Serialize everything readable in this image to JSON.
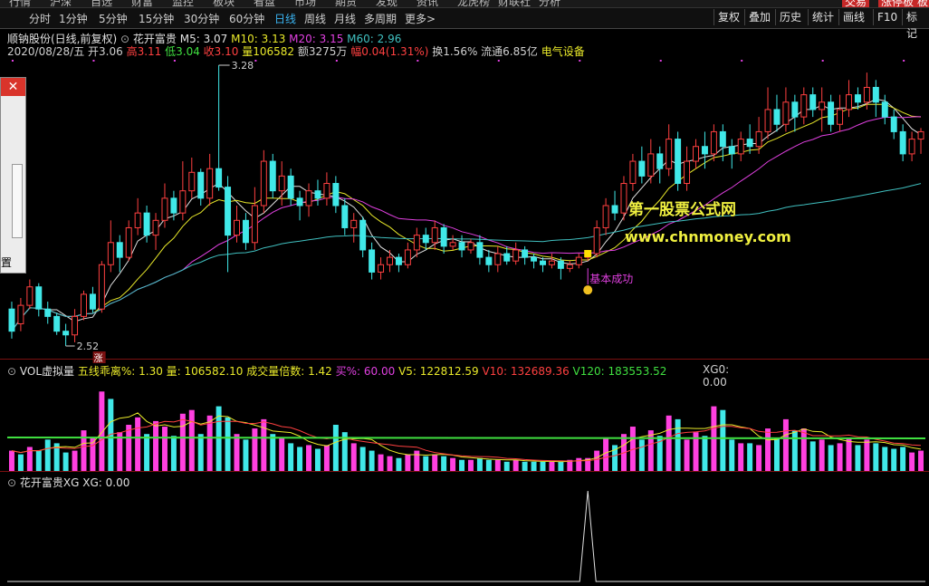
{
  "topmenu": {
    "items": [
      "行情",
      "沪深",
      "自选",
      "财富",
      "监控",
      "板块",
      "看盘",
      "市场",
      "期货",
      "发现",
      "资讯",
      "龙虎榜",
      "财联社",
      "分析"
    ],
    "right_items": [
      "交易",
      "涨停板",
      "板"
    ]
  },
  "tabs": {
    "items": [
      "分时",
      "1分钟",
      "5分钟",
      "15分钟",
      "30分钟",
      "60分钟",
      "日线",
      "周线",
      "月线",
      "多周期",
      "更多"
    ],
    "active": "日线",
    "right_buttons": [
      "复权",
      "叠加",
      "历史",
      "统计",
      "画线",
      "F10",
      "标记"
    ]
  },
  "stock": {
    "name_line": "顺钠股份(日线,前复权)",
    "indicator_name": "花开富贵",
    "ma": [
      {
        "label": "M5: 3.07",
        "color": "#e0e0e0"
      },
      {
        "label": "M10: 3.13",
        "color": "#e8e82a"
      },
      {
        "label": "M20: 3.15",
        "color": "#e040e0"
      },
      {
        "label": "M60: 2.96",
        "color": "#40c0c0"
      }
    ],
    "quote": [
      {
        "text": "2020/08/28/五",
        "color": "#d0d0d0"
      },
      {
        "text": "开3.06",
        "color": "#d0d0d0"
      },
      {
        "text": "高3.11",
        "color": "#ff4040"
      },
      {
        "text": "低3.04",
        "color": "#40e040"
      },
      {
        "text": "收3.10",
        "color": "#ff4040"
      },
      {
        "text": "量106582",
        "color": "#e8e82a"
      },
      {
        "text": "额3275万",
        "color": "#d0d0d0"
      },
      {
        "text": "幅0.04(1.31%)",
        "color": "#ff4040"
      },
      {
        "text": "换1.56%",
        "color": "#d0d0d0"
      },
      {
        "text": "流通6.85亿",
        "color": "#d0d0d0"
      },
      {
        "text": "电气设备",
        "color": "#e8e82a"
      }
    ],
    "high_label": "3.28",
    "low_label": "2.52",
    "zhang_badge": "涨",
    "signal_label": "基本成功",
    "watermark_line1": "第一股票公式网",
    "watermark_line2": "www.chnmoney.com"
  },
  "volume_pane": {
    "title": "VOL虚拟量",
    "fields": [
      {
        "text": "五线乖离%: 1.30",
        "color": "#e8e82a"
      },
      {
        "text": "量: 106582.10",
        "color": "#e8e82a"
      },
      {
        "text": "成交量倍数: 1.42",
        "color": "#e8e82a"
      },
      {
        "text": "买%: 60.00",
        "color": "#e040e0"
      },
      {
        "text": "V5: 122812.59",
        "color": "#e8e82a"
      },
      {
        "text": "V10: 132689.36",
        "color": "#ff4040"
      },
      {
        "text": "V120: 183553.52",
        "color": "#40e040"
      },
      {
        "text": "XG0: 0.00",
        "color": "#d0d0d0"
      }
    ]
  },
  "xg_pane": {
    "title": "花开富贵XG",
    "value": "XG: 0.00"
  },
  "dialog": {
    "close_symbol": "✕",
    "partial_text": "置"
  },
  "colors": {
    "up": "#ff4040",
    "down": "#40e8e8",
    "ma5": "#e0e0e0",
    "ma10": "#e8e82a",
    "ma20": "#e040e0",
    "ma60": "#40c0c0",
    "vol_up": "#ff40e0",
    "vol_down": "#40e8e8"
  },
  "chart_data": {
    "type": "candlestick",
    "ylim": [
      2.52,
      3.28
    ],
    "candles": [
      {
        "o": 2.62,
        "c": 2.56,
        "h": 2.64,
        "l": 2.54
      },
      {
        "o": 2.58,
        "c": 2.63,
        "h": 2.65,
        "l": 2.56
      },
      {
        "o": 2.63,
        "c": 2.68,
        "h": 2.7,
        "l": 2.62
      },
      {
        "o": 2.68,
        "c": 2.62,
        "h": 2.69,
        "l": 2.6
      },
      {
        "o": 2.62,
        "c": 2.6,
        "h": 2.64,
        "l": 2.58
      },
      {
        "o": 2.6,
        "c": 2.56,
        "h": 2.61,
        "l": 2.55
      },
      {
        "o": 2.56,
        "c": 2.55,
        "h": 2.58,
        "l": 2.52
      },
      {
        "o": 2.55,
        "c": 2.6,
        "h": 2.62,
        "l": 2.53
      },
      {
        "o": 2.6,
        "c": 2.66,
        "h": 2.67,
        "l": 2.59
      },
      {
        "o": 2.66,
        "c": 2.62,
        "h": 2.68,
        "l": 2.61
      },
      {
        "o": 2.62,
        "c": 2.74,
        "h": 2.75,
        "l": 2.61
      },
      {
        "o": 2.74,
        "c": 2.8,
        "h": 2.86,
        "l": 2.72
      },
      {
        "o": 2.8,
        "c": 2.76,
        "h": 2.82,
        "l": 2.72
      },
      {
        "o": 2.76,
        "c": 2.84,
        "h": 2.86,
        "l": 2.75
      },
      {
        "o": 2.84,
        "c": 2.88,
        "h": 2.92,
        "l": 2.82
      },
      {
        "o": 2.88,
        "c": 2.82,
        "h": 2.9,
        "l": 2.8
      },
      {
        "o": 2.82,
        "c": 2.86,
        "h": 2.88,
        "l": 2.78
      },
      {
        "o": 2.86,
        "c": 2.92,
        "h": 2.96,
        "l": 2.84
      },
      {
        "o": 2.92,
        "c": 2.88,
        "h": 2.94,
        "l": 2.86
      },
      {
        "o": 2.88,
        "c": 2.94,
        "h": 3.02,
        "l": 2.86
      },
      {
        "o": 2.94,
        "c": 2.99,
        "h": 3.03,
        "l": 2.92
      },
      {
        "o": 2.99,
        "c": 2.92,
        "h": 3.0,
        "l": 2.9
      },
      {
        "o": 2.92,
        "c": 3.0,
        "h": 3.04,
        "l": 2.9
      },
      {
        "o": 3.0,
        "c": 2.95,
        "h": 3.28,
        "l": 2.94
      },
      {
        "o": 2.95,
        "c": 2.82,
        "h": 2.98,
        "l": 2.72
      },
      {
        "o": 2.82,
        "c": 2.86,
        "h": 2.9,
        "l": 2.8
      },
      {
        "o": 2.86,
        "c": 2.8,
        "h": 2.88,
        "l": 2.78
      },
      {
        "o": 2.8,
        "c": 2.9,
        "h": 2.95,
        "l": 2.78
      },
      {
        "o": 2.9,
        "c": 3.02,
        "h": 3.05,
        "l": 2.88
      },
      {
        "o": 3.02,
        "c": 2.94,
        "h": 3.04,
        "l": 2.92
      },
      {
        "o": 2.94,
        "c": 2.98,
        "h": 3.02,
        "l": 2.9
      },
      {
        "o": 2.98,
        "c": 2.92,
        "h": 3.0,
        "l": 2.9
      },
      {
        "o": 2.92,
        "c": 2.9,
        "h": 2.94,
        "l": 2.86
      },
      {
        "o": 2.9,
        "c": 2.94,
        "h": 2.96,
        "l": 2.87
      },
      {
        "o": 2.94,
        "c": 2.92,
        "h": 2.97,
        "l": 2.9
      },
      {
        "o": 2.92,
        "c": 2.96,
        "h": 2.99,
        "l": 2.9
      },
      {
        "o": 2.96,
        "c": 2.9,
        "h": 2.98,
        "l": 2.88
      },
      {
        "o": 2.9,
        "c": 2.84,
        "h": 2.92,
        "l": 2.82
      },
      {
        "o": 2.84,
        "c": 2.86,
        "h": 2.88,
        "l": 2.8
      },
      {
        "o": 2.86,
        "c": 2.78,
        "h": 2.87,
        "l": 2.76
      },
      {
        "o": 2.78,
        "c": 2.72,
        "h": 2.8,
        "l": 2.7
      },
      {
        "o": 2.72,
        "c": 2.74,
        "h": 2.76,
        "l": 2.7
      },
      {
        "o": 2.74,
        "c": 2.76,
        "h": 2.78,
        "l": 2.72
      },
      {
        "o": 2.76,
        "c": 2.74,
        "h": 2.77,
        "l": 2.72
      },
      {
        "o": 2.74,
        "c": 2.78,
        "h": 2.8,
        "l": 2.73
      },
      {
        "o": 2.78,
        "c": 2.82,
        "h": 2.84,
        "l": 2.76
      },
      {
        "o": 2.82,
        "c": 2.8,
        "h": 2.84,
        "l": 2.78
      },
      {
        "o": 2.8,
        "c": 2.84,
        "h": 2.86,
        "l": 2.78
      },
      {
        "o": 2.84,
        "c": 2.79,
        "h": 2.85,
        "l": 2.77
      },
      {
        "o": 2.79,
        "c": 2.8,
        "h": 2.82,
        "l": 2.78
      },
      {
        "o": 2.8,
        "c": 2.78,
        "h": 2.82,
        "l": 2.76
      },
      {
        "o": 2.78,
        "c": 2.8,
        "h": 2.81,
        "l": 2.77
      },
      {
        "o": 2.8,
        "c": 2.76,
        "h": 2.82,
        "l": 2.74
      },
      {
        "o": 2.76,
        "c": 2.74,
        "h": 2.78,
        "l": 2.72
      },
      {
        "o": 2.74,
        "c": 2.77,
        "h": 2.79,
        "l": 2.72
      },
      {
        "o": 2.77,
        "c": 2.75,
        "h": 2.79,
        "l": 2.74
      },
      {
        "o": 2.75,
        "c": 2.78,
        "h": 2.8,
        "l": 2.74
      },
      {
        "o": 2.78,
        "c": 2.76,
        "h": 2.79,
        "l": 2.74
      },
      {
        "o": 2.76,
        "c": 2.75,
        "h": 2.77,
        "l": 2.73
      },
      {
        "o": 2.75,
        "c": 2.74,
        "h": 2.76,
        "l": 2.72
      },
      {
        "o": 2.74,
        "c": 2.75,
        "h": 2.77,
        "l": 2.73
      },
      {
        "o": 2.75,
        "c": 2.73,
        "h": 2.76,
        "l": 2.7
      },
      {
        "o": 2.73,
        "c": 2.74,
        "h": 2.75,
        "l": 2.72
      },
      {
        "o": 2.74,
        "c": 2.76,
        "h": 2.77,
        "l": 2.73
      },
      {
        "o": 2.76,
        "c": 2.77,
        "h": 2.78,
        "l": 2.75
      },
      {
        "o": 2.77,
        "c": 2.84,
        "h": 2.86,
        "l": 2.76
      },
      {
        "o": 2.84,
        "c": 2.9,
        "h": 2.92,
        "l": 2.82
      },
      {
        "o": 2.9,
        "c": 2.88,
        "h": 2.94,
        "l": 2.86
      },
      {
        "o": 2.88,
        "c": 2.96,
        "h": 2.98,
        "l": 2.86
      },
      {
        "o": 2.96,
        "c": 3.02,
        "h": 3.04,
        "l": 2.94
      },
      {
        "o": 3.02,
        "c": 2.98,
        "h": 3.06,
        "l": 2.96
      },
      {
        "o": 2.98,
        "c": 3.04,
        "h": 3.08,
        "l": 2.96
      },
      {
        "o": 3.04,
        "c": 3.0,
        "h": 3.06,
        "l": 2.96
      },
      {
        "o": 3.0,
        "c": 3.08,
        "h": 3.12,
        "l": 2.98
      },
      {
        "o": 3.08,
        "c": 2.96,
        "h": 3.1,
        "l": 2.94
      },
      {
        "o": 2.96,
        "c": 3.02,
        "h": 3.06,
        "l": 2.94
      },
      {
        "o": 3.02,
        "c": 3.06,
        "h": 3.08,
        "l": 3.0
      },
      {
        "o": 3.06,
        "c": 3.04,
        "h": 3.1,
        "l": 3.0
      },
      {
        "o": 3.04,
        "c": 3.1,
        "h": 3.12,
        "l": 3.02
      },
      {
        "o": 3.1,
        "c": 3.06,
        "h": 3.12,
        "l": 3.02
      },
      {
        "o": 3.06,
        "c": 3.04,
        "h": 3.08,
        "l": 3.0
      },
      {
        "o": 3.04,
        "c": 3.08,
        "h": 3.1,
        "l": 3.02
      },
      {
        "o": 3.08,
        "c": 3.06,
        "h": 3.12,
        "l": 3.04
      },
      {
        "o": 3.06,
        "c": 3.1,
        "h": 3.14,
        "l": 3.04
      },
      {
        "o": 3.1,
        "c": 3.16,
        "h": 3.22,
        "l": 3.08
      },
      {
        "o": 3.16,
        "c": 3.12,
        "h": 3.2,
        "l": 3.1
      },
      {
        "o": 3.12,
        "c": 3.18,
        "h": 3.22,
        "l": 3.1
      },
      {
        "o": 3.18,
        "c": 3.14,
        "h": 3.2,
        "l": 3.1
      },
      {
        "o": 3.14,
        "c": 3.2,
        "h": 3.22,
        "l": 3.12
      },
      {
        "o": 3.2,
        "c": 3.16,
        "h": 3.22,
        "l": 3.14
      },
      {
        "o": 3.16,
        "c": 3.18,
        "h": 3.22,
        "l": 3.1
      },
      {
        "o": 3.18,
        "c": 3.12,
        "h": 3.2,
        "l": 3.1
      },
      {
        "o": 3.12,
        "c": 3.16,
        "h": 3.2,
        "l": 3.1
      },
      {
        "o": 3.16,
        "c": 3.2,
        "h": 3.24,
        "l": 3.14
      },
      {
        "o": 3.2,
        "c": 3.18,
        "h": 3.22,
        "l": 3.16
      },
      {
        "o": 3.18,
        "c": 3.22,
        "h": 3.26,
        "l": 3.16
      },
      {
        "o": 3.22,
        "c": 3.18,
        "h": 3.24,
        "l": 3.14
      },
      {
        "o": 3.18,
        "c": 3.14,
        "h": 3.2,
        "l": 3.12
      },
      {
        "o": 3.14,
        "c": 3.1,
        "h": 3.16,
        "l": 3.08
      },
      {
        "o": 3.1,
        "c": 3.04,
        "h": 3.12,
        "l": 3.02
      },
      {
        "o": 3.04,
        "c": 3.08,
        "h": 3.1,
        "l": 3.02
      },
      {
        "o": 3.08,
        "c": 3.1,
        "h": 3.11,
        "l": 3.04
      }
    ],
    "volume": [
      {
        "v": 0.22,
        "up": true
      },
      {
        "v": 0.18,
        "up": false
      },
      {
        "v": 0.26,
        "up": true
      },
      {
        "v": 0.22,
        "up": false
      },
      {
        "v": 0.34,
        "up": false
      },
      {
        "v": 0.3,
        "up": false
      },
      {
        "v": 0.2,
        "up": false
      },
      {
        "v": 0.22,
        "up": true
      },
      {
        "v": 0.44,
        "up": true
      },
      {
        "v": 0.36,
        "up": true
      },
      {
        "v": 0.86,
        "up": true
      },
      {
        "v": 0.78,
        "up": false
      },
      {
        "v": 0.42,
        "up": true
      },
      {
        "v": 0.5,
        "up": true
      },
      {
        "v": 0.58,
        "up": true
      },
      {
        "v": 0.4,
        "up": false
      },
      {
        "v": 0.54,
        "up": true
      },
      {
        "v": 0.48,
        "up": true
      },
      {
        "v": 0.38,
        "up": false
      },
      {
        "v": 0.62,
        "up": true
      },
      {
        "v": 0.66,
        "up": true
      },
      {
        "v": 0.4,
        "up": false
      },
      {
        "v": 0.6,
        "up": true
      },
      {
        "v": 0.7,
        "up": false
      },
      {
        "v": 0.58,
        "up": false
      },
      {
        "v": 0.4,
        "up": true
      },
      {
        "v": 0.34,
        "up": false
      },
      {
        "v": 0.46,
        "up": true
      },
      {
        "v": 0.56,
        "up": true
      },
      {
        "v": 0.4,
        "up": false
      },
      {
        "v": 0.36,
        "up": true
      },
      {
        "v": 0.3,
        "up": false
      },
      {
        "v": 0.26,
        "up": false
      },
      {
        "v": 0.28,
        "up": true
      },
      {
        "v": 0.24,
        "up": false
      },
      {
        "v": 0.28,
        "up": true
      },
      {
        "v": 0.5,
        "up": false
      },
      {
        "v": 0.42,
        "up": false
      },
      {
        "v": 0.3,
        "up": true
      },
      {
        "v": 0.26,
        "up": false
      },
      {
        "v": 0.22,
        "up": false
      },
      {
        "v": 0.18,
        "up": true
      },
      {
        "v": 0.16,
        "up": true
      },
      {
        "v": 0.14,
        "up": false
      },
      {
        "v": 0.18,
        "up": true
      },
      {
        "v": 0.22,
        "up": true
      },
      {
        "v": 0.16,
        "up": false
      },
      {
        "v": 0.18,
        "up": true
      },
      {
        "v": 0.16,
        "up": false
      },
      {
        "v": 0.14,
        "up": true
      },
      {
        "v": 0.12,
        "up": false
      },
      {
        "v": 0.12,
        "up": true
      },
      {
        "v": 0.14,
        "up": false
      },
      {
        "v": 0.12,
        "up": false
      },
      {
        "v": 0.12,
        "up": true
      },
      {
        "v": 0.1,
        "up": false
      },
      {
        "v": 0.12,
        "up": true
      },
      {
        "v": 0.1,
        "up": false
      },
      {
        "v": 0.1,
        "up": false
      },
      {
        "v": 0.1,
        "up": false
      },
      {
        "v": 0.1,
        "up": true
      },
      {
        "v": 0.1,
        "up": false
      },
      {
        "v": 0.12,
        "up": true
      },
      {
        "v": 0.14,
        "up": true
      },
      {
        "v": 0.14,
        "up": true
      },
      {
        "v": 0.22,
        "up": true
      },
      {
        "v": 0.36,
        "up": true
      },
      {
        "v": 0.28,
        "up": false
      },
      {
        "v": 0.4,
        "up": true
      },
      {
        "v": 0.48,
        "up": true
      },
      {
        "v": 0.34,
        "up": false
      },
      {
        "v": 0.44,
        "up": true
      },
      {
        "v": 0.38,
        "up": false
      },
      {
        "v": 0.6,
        "up": true
      },
      {
        "v": 0.56,
        "up": false
      },
      {
        "v": 0.34,
        "up": true
      },
      {
        "v": 0.42,
        "up": true
      },
      {
        "v": 0.38,
        "up": false
      },
      {
        "v": 0.7,
        "up": true
      },
      {
        "v": 0.66,
        "up": false
      },
      {
        "v": 0.34,
        "up": false
      },
      {
        "v": 0.3,
        "up": true
      },
      {
        "v": 0.3,
        "up": false
      },
      {
        "v": 0.28,
        "up": true
      },
      {
        "v": 0.46,
        "up": true
      },
      {
        "v": 0.36,
        "up": false
      },
      {
        "v": 0.56,
        "up": true
      },
      {
        "v": 0.44,
        "up": false
      },
      {
        "v": 0.46,
        "up": true
      },
      {
        "v": 0.32,
        "up": false
      },
      {
        "v": 0.34,
        "up": true
      },
      {
        "v": 0.28,
        "up": false
      },
      {
        "v": 0.3,
        "up": true
      },
      {
        "v": 0.36,
        "up": true
      },
      {
        "v": 0.28,
        "up": false
      },
      {
        "v": 0.34,
        "up": true
      },
      {
        "v": 0.3,
        "up": false
      },
      {
        "v": 0.26,
        "up": false
      },
      {
        "v": 0.24,
        "up": false
      },
      {
        "v": 0.26,
        "up": false
      },
      {
        "v": 0.2,
        "up": true
      },
      {
        "v": 0.22,
        "up": true
      }
    ],
    "signal_index": 64,
    "xg_spike_index": 64
  }
}
